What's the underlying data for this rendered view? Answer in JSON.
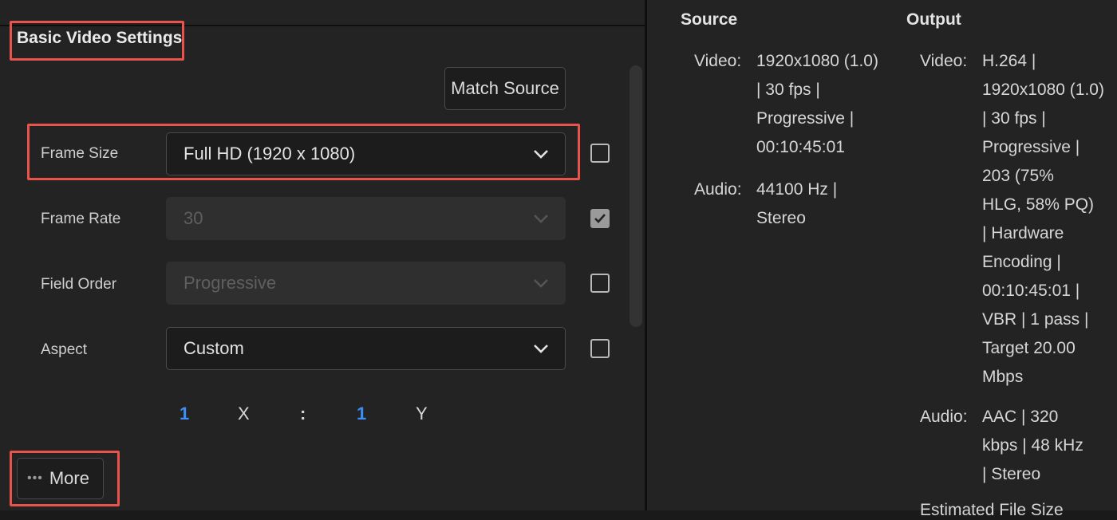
{
  "section": {
    "title": "Basic Video Settings",
    "match_source_label": "Match Source",
    "more_label": "More"
  },
  "rows": [
    {
      "label": "Frame Size",
      "value": "Full HD (1920 x 1080)",
      "enabled": true,
      "checked": false
    },
    {
      "label": "Frame Rate",
      "value": "30",
      "enabled": false,
      "checked": true
    },
    {
      "label": "Field Order",
      "value": "Progressive",
      "enabled": false,
      "checked": false
    },
    {
      "label": "Aspect",
      "value": "Custom",
      "enabled": true,
      "checked": false
    }
  ],
  "aspect_ratio": {
    "x_value": "1",
    "x_label": "X",
    "colon": ":",
    "y_value": "1",
    "y_label": "Y"
  },
  "source": {
    "title": "Source",
    "video_label": "Video:",
    "video_lines": [
      "1920x1080 (1.0)",
      "| 30 fps |",
      "Progressive |",
      "00:10:45:01"
    ],
    "audio_label": "Audio:",
    "audio_lines": [
      "44100 Hz |",
      "Stereo"
    ]
  },
  "output": {
    "title": "Output",
    "video_label": "Video:",
    "video_lines": [
      "H.264 |",
      "1920x1080 (1.0)",
      "| 30 fps |",
      "Progressive |",
      "203 (75%",
      "HLG, 58% PQ)",
      "| Hardware",
      "Encoding |",
      "00:10:45:01 |",
      "VBR | 1 pass |",
      "Target 20.00",
      "Mbps"
    ],
    "audio_label": "Audio:",
    "audio_lines": [
      "AAC | 320",
      "kbps | 48 kHz",
      "| Stereo"
    ],
    "partial_next_line": "Estimated File Size"
  },
  "colors": {
    "highlight": "#e8544b",
    "accent_blue": "#3d8ef7",
    "background": "#232323"
  },
  "icons": [
    "chevron-down-icon",
    "checkmark-icon",
    "more-dots-icon"
  ]
}
